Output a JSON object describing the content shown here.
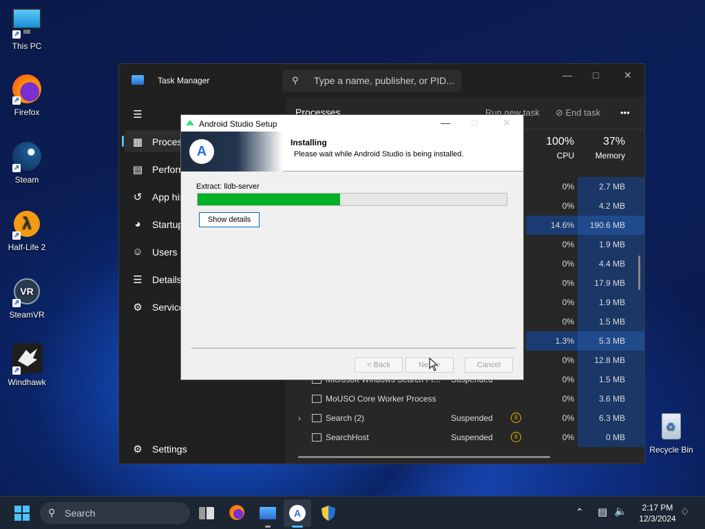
{
  "desktop": {
    "icons": [
      {
        "label": "This PC",
        "icon": "monitor-icon"
      },
      {
        "label": "Firefox",
        "icon": "firefox-icon"
      },
      {
        "label": "Steam",
        "icon": "steam-icon"
      },
      {
        "label": "Half-Life 2",
        "icon": "half-life-icon"
      },
      {
        "label": "SteamVR",
        "icon": "steamvr-icon"
      },
      {
        "label": "Windhawk",
        "icon": "windhawk-icon"
      },
      {
        "label": "Recycle Bin",
        "icon": "recycle-bin-icon"
      }
    ]
  },
  "task_manager": {
    "title": "Task Manager",
    "search_placeholder": "Type a name, publisher, or PID...",
    "nav": [
      {
        "label": "Process",
        "icon": "grid-icon"
      },
      {
        "label": "Perforn",
        "icon": "performance-icon"
      },
      {
        "label": "App his",
        "icon": "history-icon"
      },
      {
        "label": "Startup",
        "icon": "startup-icon"
      },
      {
        "label": "Users",
        "icon": "users-icon"
      },
      {
        "label": "Details",
        "icon": "list-icon"
      },
      {
        "label": "Service",
        "icon": "services-icon"
      }
    ],
    "settings_label": "Settings",
    "page_title": "Processes",
    "toolbar": {
      "run_new_task": "Run new task",
      "end_task": "End task",
      "more": "•••"
    },
    "columns": {
      "cpu_pct": "100%",
      "cpu_label": "CPU",
      "mem_pct": "37%",
      "mem_label": "Memory"
    },
    "rows": [
      {
        "name": "",
        "status": "",
        "cpu": "0%",
        "mem": "2.7 MB"
      },
      {
        "name": "",
        "status": "",
        "cpu": "0%",
        "mem": "4.2 MB"
      },
      {
        "name": "",
        "status": "",
        "cpu": "14.6%",
        "mem": "190.6 MB"
      },
      {
        "name": "",
        "status": "",
        "cpu": "0%",
        "mem": "1.9 MB"
      },
      {
        "name": "",
        "status": "",
        "cpu": "0%",
        "mem": "4.4 MB"
      },
      {
        "name": "",
        "status": "",
        "cpu": "0%",
        "mem": "17.9 MB"
      },
      {
        "name": "",
        "status": "",
        "cpu": "0%",
        "mem": "1.9 MB"
      },
      {
        "name": "",
        "status": "",
        "cpu": "0%",
        "mem": "1.5 MB"
      },
      {
        "name": "",
        "status": "",
        "cpu": "1.3%",
        "mem": "5.3 MB"
      },
      {
        "name": "",
        "status": "",
        "cpu": "0%",
        "mem": "12.8 MB"
      },
      {
        "name": "Microsoft Windows Search Pr...",
        "status": "Suspended",
        "cpu": "0%",
        "mem": "1.5 MB"
      },
      {
        "name": "MoUSO Core Worker Process",
        "status": "",
        "cpu": "0%",
        "mem": "3.6 MB"
      },
      {
        "name": "Search (2)",
        "status": "Suspended",
        "cpu": "0%",
        "mem": "6.3 MB"
      },
      {
        "name": "SearchHost",
        "status": "Suspended",
        "cpu": "0%",
        "mem": "0 MB"
      }
    ]
  },
  "setup_dialog": {
    "title": "Android Studio Setup",
    "heading": "Installing",
    "subheading": "Please wait while Android Studio is being installed.",
    "extract_text": "Extract: lldb-server",
    "progress": 0.46,
    "show_details": "Show details",
    "back": "< Back",
    "next": "Next >",
    "cancel": "Cancel"
  },
  "taskbar": {
    "search_label": "Search",
    "time": "2:17 PM",
    "date": "12/3/2024"
  }
}
